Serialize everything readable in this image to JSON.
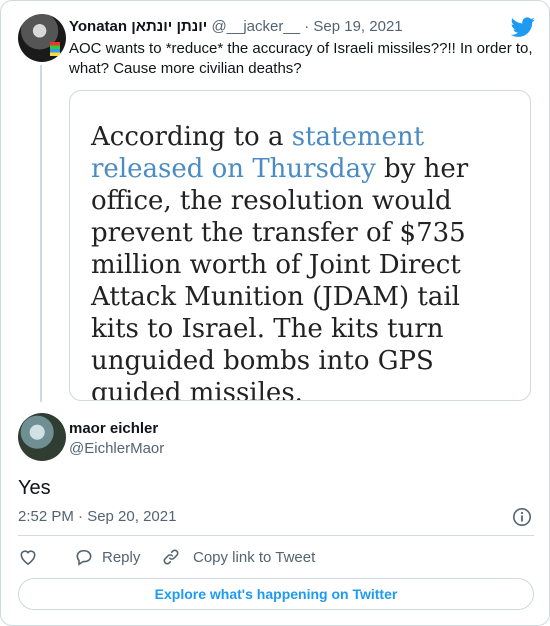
{
  "parent_tweet": {
    "name": "Yonatan",
    "name_hebrew": "יונתן יונתאן",
    "handle": "@__jacker__",
    "separator": "·",
    "date": "Sep 19, 2021",
    "text": "AOC wants to *reduce* the accuracy of Israeli missiles??!! In order to, what? Cause more civilian deaths?",
    "quote_image": {
      "text_before": "According to a ",
      "link_text": "statement released on Thursday",
      "text_after": " by her office, the resolution would prevent the transfer of $735 million worth of Joint Direct Attack Munition (JDAM) tail kits to Israel. The kits turn unguided bombs into GPS guided missiles."
    }
  },
  "reply_tweet": {
    "name": "maor eichler",
    "handle": "@EichlerMaor",
    "text": "Yes",
    "timestamp": "2:52 PM · Sep 20, 2021"
  },
  "actions": {
    "like_icon": "heart-icon",
    "reply_label": "Reply",
    "copy_label": "Copy link to Tweet"
  },
  "explore_button": "Explore what's happening on Twitter",
  "colors": {
    "accent": "#1d9bf0",
    "secondary_text": "#536471",
    "border": "#cfd9de",
    "quote_link": "#4b8bc4"
  }
}
